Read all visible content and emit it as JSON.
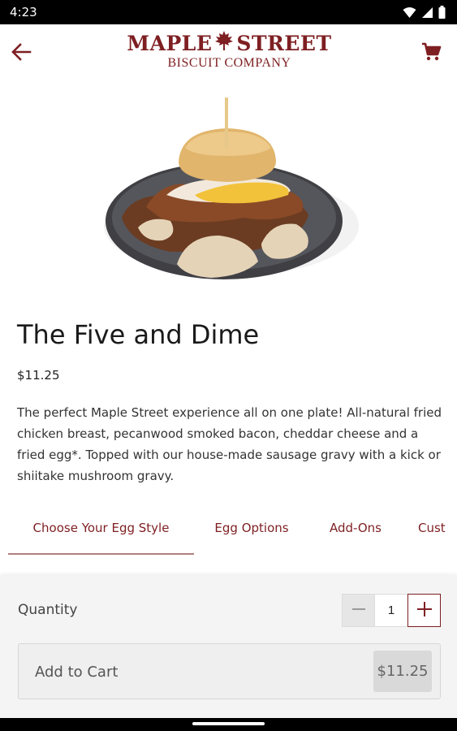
{
  "status_bar": {
    "time": "4:23",
    "icons": [
      "wifi-icon",
      "signal-icon",
      "battery-icon"
    ]
  },
  "header": {
    "logo_line1_left": "MAPLE",
    "logo_line1_right": "STREET",
    "logo_line2": "BISCUIT COMPANY",
    "icons": [
      "back-arrow-icon",
      "maple-leaf-icon",
      "cart-icon"
    ]
  },
  "product": {
    "title": "The Five and Dime",
    "price": "$11.25",
    "description": "The perfect Maple Street experience all on one plate! All-natural fried chicken breast, pecanwood smoked bacon, cheddar cheese and a fried egg*. Topped with our house-made sausage gravy with a kick or shiitake mushroom gravy."
  },
  "tabs": [
    {
      "label": "Choose Your Egg Style",
      "active": true
    },
    {
      "label": "Egg Options",
      "active": false
    },
    {
      "label": "Add-Ons",
      "active": false
    },
    {
      "label": "Cust",
      "active": false
    }
  ],
  "order": {
    "quantity_label": "Quantity",
    "quantity_value": "1",
    "add_to_cart_label": "Add to Cart",
    "add_to_cart_amount": "$11.25"
  },
  "colors": {
    "brand": "#7e1f22",
    "panel": "#f4f4f4"
  }
}
